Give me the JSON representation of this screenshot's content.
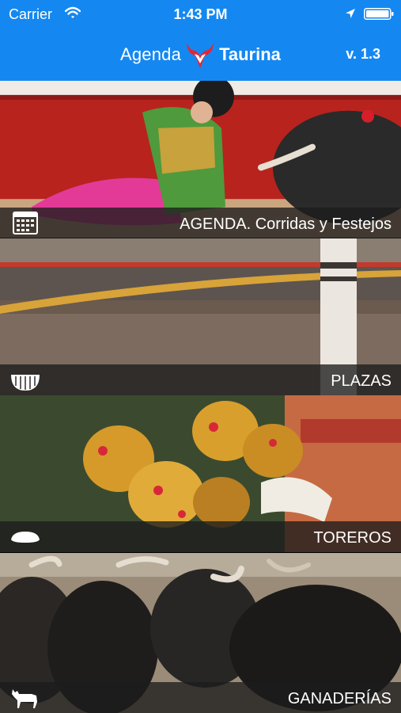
{
  "status_bar": {
    "carrier": "Carrier",
    "time": "1:43 PM",
    "icons": [
      "wifi-icon",
      "location-arrow-icon",
      "battery-icon"
    ]
  },
  "nav": {
    "logo_word_1": "Agenda",
    "logo_word_2": "Taurina",
    "logo_icon": "bull-head-logo-icon",
    "version": "v. 1.3",
    "background": "#1488f0"
  },
  "menu": [
    {
      "label": "AGENDA. Corridas y Festejos",
      "icon": "calendar-icon"
    },
    {
      "label": "PLAZAS",
      "icon": "bullring-icon"
    },
    {
      "label": "TOREROS",
      "icon": "montera-hat-icon"
    },
    {
      "label": "GANADERÍAS",
      "icon": "bull-silhouette-icon"
    }
  ]
}
